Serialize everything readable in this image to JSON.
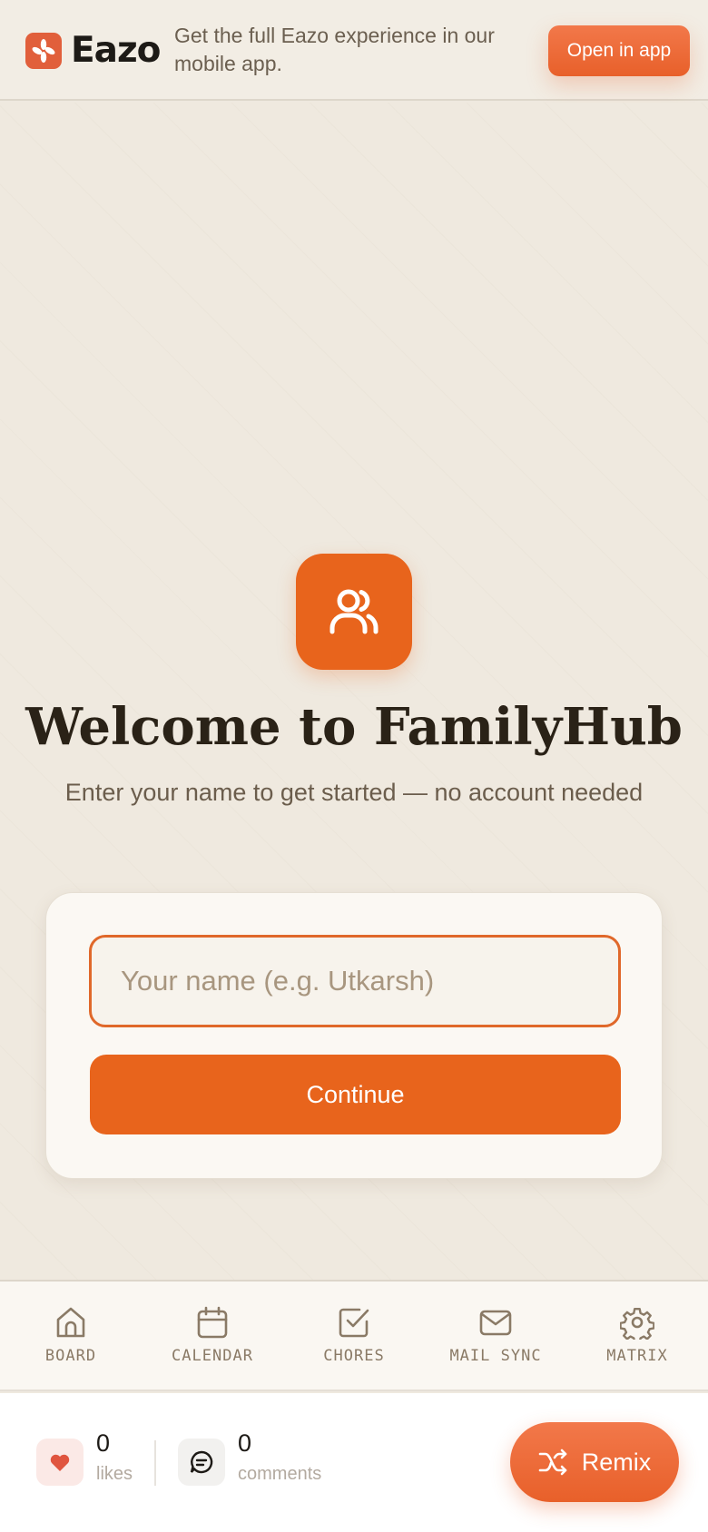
{
  "banner": {
    "brand": "Eazo",
    "message": "Get the full Eazo experience in our mobile app.",
    "open_button": "Open in app"
  },
  "welcome": {
    "icon": "users-icon",
    "title": "Welcome to FamilyHub",
    "subtitle": "Enter your name to get started — no account needed"
  },
  "form": {
    "name_placeholder": "Your name (e.g. Utkarsh)",
    "name_value": "",
    "continue_label": "Continue"
  },
  "nav": {
    "items": [
      {
        "label": "BOARD",
        "icon": "home-icon"
      },
      {
        "label": "CALENDAR",
        "icon": "calendar-icon"
      },
      {
        "label": "CHORES",
        "icon": "checkbox-icon"
      },
      {
        "label": "MAIL SYNC",
        "icon": "mail-icon"
      },
      {
        "label": "MATRIX",
        "icon": "gear-icon"
      }
    ]
  },
  "footer": {
    "likes_count": "0",
    "likes_label": "likes",
    "comments_count": "0",
    "comments_label": "comments",
    "remix_label": "Remix"
  },
  "colors": {
    "accent": "#e8641c",
    "background": "#efe9df",
    "brand_logo": "#e15f3b"
  }
}
